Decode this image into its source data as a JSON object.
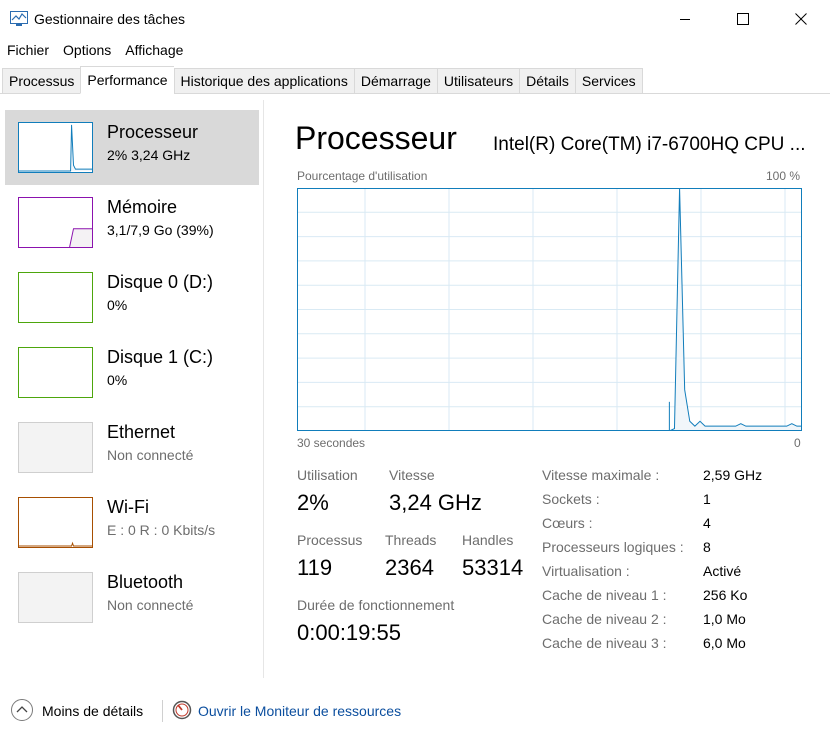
{
  "window": {
    "title": "Gestionnaire des tâches"
  },
  "menu": [
    "Fichier",
    "Options",
    "Affichage"
  ],
  "tabs": [
    "Processus",
    "Performance",
    "Historique des applications",
    "Démarrage",
    "Utilisateurs",
    "Détails",
    "Services"
  ],
  "active_tab": "Performance",
  "sidebar": [
    {
      "name": "Processeur",
      "sub": "2% 3,24 GHz",
      "color": "#117dbb"
    },
    {
      "name": "Mémoire",
      "sub": "3,1/7,9 Go (39%)",
      "color": "#8b12ae"
    },
    {
      "name": "Disque 0 (D:)",
      "sub": "0%",
      "color": "#4da60c"
    },
    {
      "name": "Disque 1 (C:)",
      "sub": "0%",
      "color": "#4da60c"
    },
    {
      "name": "Ethernet",
      "sub": "Non connecté",
      "color": "#cfcfcf"
    },
    {
      "name": "Wi-Fi",
      "sub": "E : 0  R : 0 Kbits/s",
      "color": "#a74f01"
    },
    {
      "name": "Bluetooth",
      "sub": "Non connecté",
      "color": "#cfcfcf"
    }
  ],
  "main": {
    "title": "Processeur",
    "cpu_name": "Intel(R) Core(TM) i7-6700HQ CPU ...",
    "graph_label": "Pourcentage d'utilisation",
    "graph_max": "100 %",
    "graph_time": "30 secondes",
    "graph_min": "0"
  },
  "stats": {
    "utilisation_label": "Utilisation",
    "utilisation_value": "2%",
    "vitesse_label": "Vitesse",
    "vitesse_value": "3,24 GHz",
    "processus_label": "Processus",
    "processus_value": "119",
    "threads_label": "Threads",
    "threads_value": "2364",
    "handles_label": "Handles",
    "handles_value": "53314",
    "uptime_label": "Durée de fonctionnement",
    "uptime_value": "0:00:19:55"
  },
  "specs": [
    {
      "label": "Vitesse maximale :",
      "value": "2,59 GHz"
    },
    {
      "label": "Sockets :",
      "value": "1"
    },
    {
      "label": "Cœurs :",
      "value": "4"
    },
    {
      "label": "Processeurs logiques :",
      "value": "8"
    },
    {
      "label": "Virtualisation :",
      "value": "Activé"
    },
    {
      "label": "Cache de niveau 1 :",
      "value": "256 Ko"
    },
    {
      "label": "Cache de niveau 2 :",
      "value": "1,0 Mo"
    },
    {
      "label": "Cache de niveau 3 :",
      "value": "6,0 Mo"
    }
  ],
  "footer": {
    "less_details": "Moins de détails",
    "resource_monitor": "Ouvrir le Moniteur de ressources"
  },
  "colors": {
    "cpu": "#117dbb",
    "graph_grid": "#d9eaf4",
    "graph_fill": "#f1f6fa",
    "link": "#0b4e9e"
  },
  "cpu_history": [
    0,
    0,
    0,
    0,
    0,
    0,
    0,
    0,
    0,
    0,
    0,
    0,
    0,
    0,
    0,
    0,
    0,
    0,
    0,
    0,
    0,
    0,
    0,
    0,
    0,
    0,
    0,
    0,
    0,
    0,
    0,
    0,
    0,
    0,
    0,
    0,
    0,
    0,
    0,
    0,
    0,
    0,
    0,
    0,
    0,
    0,
    0,
    0,
    0,
    0,
    0,
    0,
    0,
    0,
    0,
    0,
    0,
    0,
    0,
    0,
    0,
    0,
    0,
    0,
    0,
    0,
    0,
    0,
    0,
    0,
    0,
    0,
    0,
    0,
    1,
    100,
    17,
    4,
    2,
    4,
    2,
    2,
    2,
    2,
    2,
    2,
    2,
    3,
    2,
    2,
    2,
    2,
    2,
    2,
    2,
    2,
    2,
    3,
    2,
    2
  ]
}
